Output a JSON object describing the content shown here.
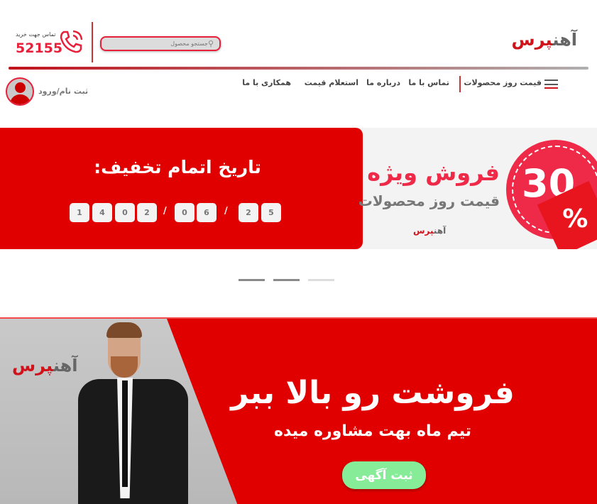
{
  "header": {
    "contact_label": "تماس جهت خرید",
    "phone": "52155",
    "search_placeholder": "جستجو محصول",
    "logo_part1": "آهن",
    "logo_part2": "پرس"
  },
  "nav": {
    "items": [
      {
        "label": "قیمت روز محصولات"
      },
      {
        "label": "تماس با ما"
      },
      {
        "label": "درباره ما"
      },
      {
        "label": "استعلام قیمت"
      },
      {
        "label": "همکاری با ما"
      }
    ],
    "login_label": "ثبت نام/ورود"
  },
  "hero": {
    "countdown_title": "تاریخ اتمام تخفیف:",
    "year": [
      "1",
      "4",
      "0",
      "2"
    ],
    "month": [
      "0",
      "6"
    ],
    "day": [
      "2",
      "5"
    ],
    "separator": "/",
    "sale_title": "فروش ویژه",
    "sale_subtitle": "قیمت روز محصولات",
    "discount": "30",
    "percent": "%",
    "slides_total": 3,
    "active_slide": 3
  },
  "promo": {
    "title": "فروشت رو بالا ببر",
    "subtitle": "تیم ماه بهت مشاوره میده",
    "button": "ثبت آگهی"
  },
  "colors": {
    "brand": "#e10000",
    "accent": "#d0121b",
    "button": "#86ec98"
  }
}
